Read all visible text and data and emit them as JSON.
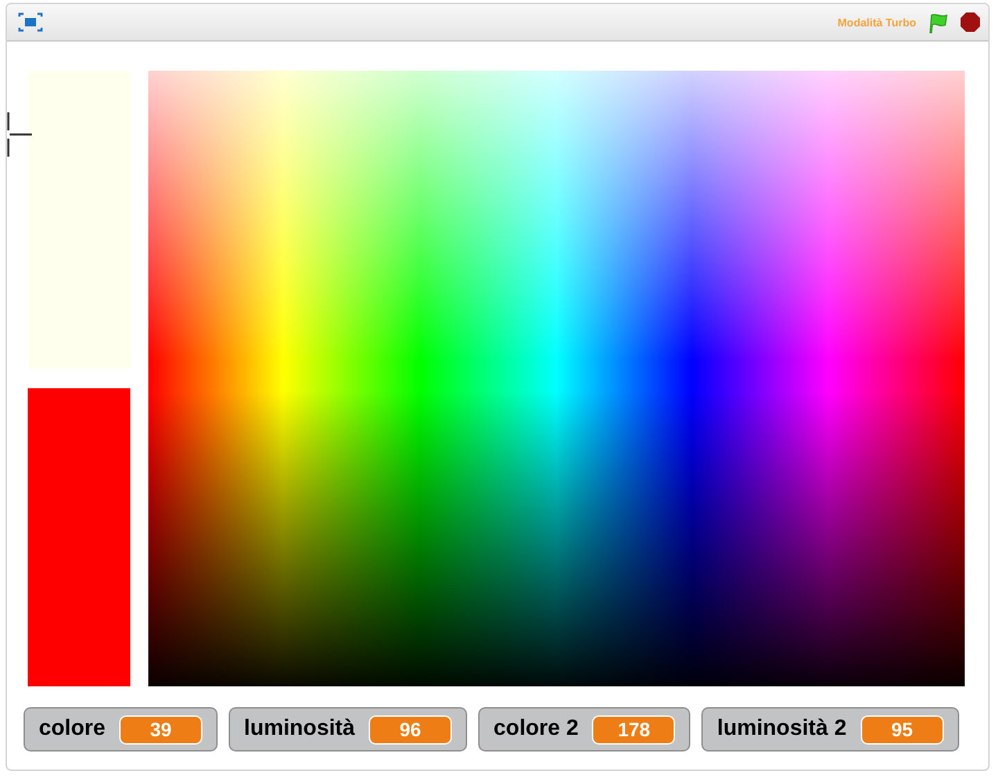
{
  "toolbar": {
    "turbo_label": "Modalità Turbo"
  },
  "swatches": [
    {
      "color": "#ffffee"
    },
    {
      "color": "#ff0000"
    }
  ],
  "monitors": [
    {
      "label": "colore",
      "value": "39"
    },
    {
      "label": "luminosità",
      "value": "96"
    },
    {
      "label": "colore 2",
      "value": "178"
    },
    {
      "label": "luminosità 2",
      "value": "95"
    }
  ]
}
